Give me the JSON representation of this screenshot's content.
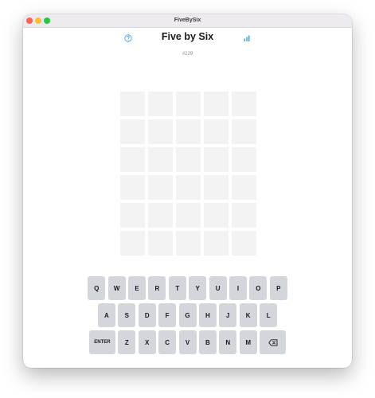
{
  "window": {
    "title": "FiveBySix"
  },
  "header": {
    "title": "Five by Six",
    "puzzle_number": "#229",
    "help_icon": "question-circle-icon",
    "stats_icon": "bar-chart-icon"
  },
  "board": {
    "rows": 6,
    "cols": 5,
    "tiles": [
      [
        "",
        "",
        "",
        "",
        ""
      ],
      [
        "",
        "",
        "",
        "",
        ""
      ],
      [
        "",
        "",
        "",
        "",
        ""
      ],
      [
        "",
        "",
        "",
        "",
        ""
      ],
      [
        "",
        "",
        "",
        "",
        ""
      ],
      [
        "",
        "",
        "",
        "",
        ""
      ]
    ]
  },
  "keyboard": {
    "rows": [
      [
        "Q",
        "W",
        "E",
        "R",
        "T",
        "Y",
        "U",
        "I",
        "O",
        "P"
      ],
      [
        "A",
        "S",
        "D",
        "F",
        "G",
        "H",
        "J",
        "K",
        "L"
      ],
      [
        "ENTER",
        "Z",
        "X",
        "C",
        "V",
        "B",
        "N",
        "M",
        "BACKSPACE"
      ]
    ],
    "backspace_icon": "backspace-icon"
  },
  "colors": {
    "accent": "#2f9de2",
    "tile_empty": "#f3f3f3",
    "key_bg": "#d3d6da"
  }
}
